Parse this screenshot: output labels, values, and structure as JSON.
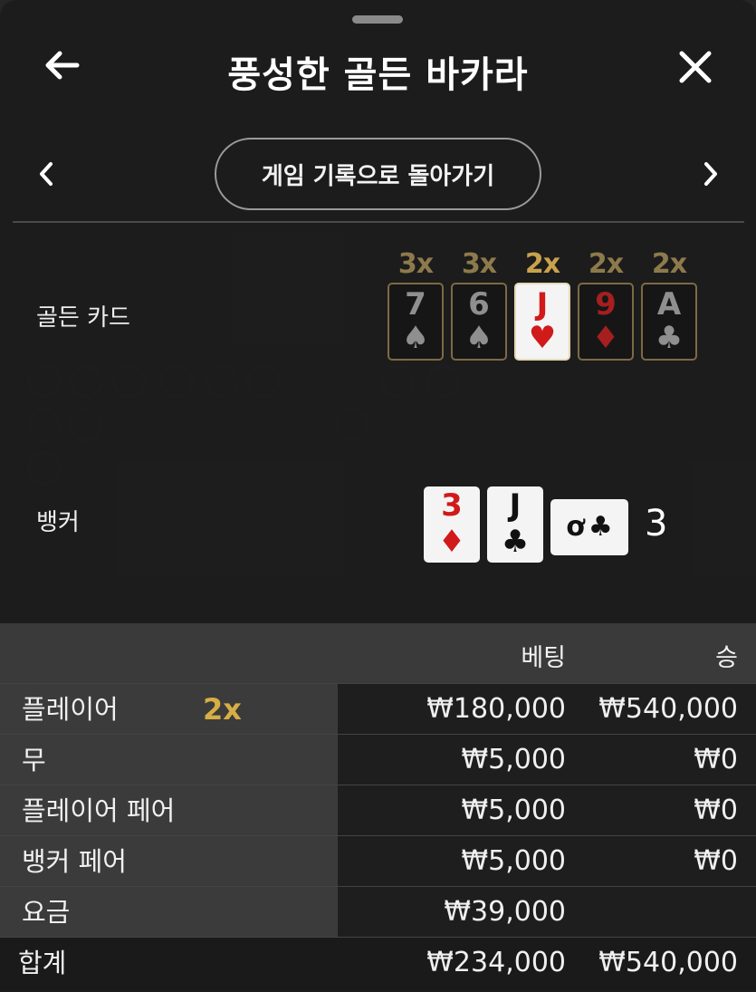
{
  "header": {
    "title": "풍성한 골든 바카라"
  },
  "nav": {
    "history_button": "게임 기록으로 돌아가기"
  },
  "golden": {
    "label": "골든 카드",
    "cards": [
      {
        "mult": "3x",
        "rank": "7",
        "suit": "♠",
        "color": "black",
        "style": "dark"
      },
      {
        "mult": "3x",
        "rank": "6",
        "suit": "♠",
        "color": "black",
        "style": "dark"
      },
      {
        "mult": "2x",
        "rank": "J",
        "suit": "♥",
        "color": "red",
        "style": "face"
      },
      {
        "mult": "2x",
        "rank": "9",
        "suit": "♦",
        "color": "red",
        "style": "dark"
      },
      {
        "mult": "2x",
        "rank": "A",
        "suit": "♣",
        "color": "black",
        "style": "dark"
      }
    ]
  },
  "banker": {
    "label": "뱅커",
    "cards": [
      {
        "rank": "3",
        "suit": "♦",
        "color": "red"
      },
      {
        "rank": "J",
        "suit": "♣",
        "color": "black"
      },
      {
        "rank": "ơ",
        "suit": "♣",
        "color": "black"
      }
    ],
    "total": "3"
  },
  "table": {
    "col_bet": "베팅",
    "col_win": "승",
    "rows": [
      {
        "label": "플레이어",
        "mult": "2x",
        "bet": "₩180,000",
        "win": "₩540,000"
      },
      {
        "label": "무",
        "mult": "",
        "bet": "₩5,000",
        "win": "₩0"
      },
      {
        "label": "플레이어 페어",
        "mult": "",
        "bet": "₩5,000",
        "win": "₩0"
      },
      {
        "label": "뱅커 페어",
        "mult": "",
        "bet": "₩5,000",
        "win": "₩0"
      },
      {
        "label": "요금",
        "mult": "",
        "bet": "₩39,000",
        "win": ""
      }
    ],
    "total": {
      "label": "합계",
      "bet": "₩234,000",
      "win": "₩540,000"
    }
  },
  "colors": {
    "gold": "#c9a24c",
    "red_suit": "#d11a1a",
    "sheet_bg": "#1c1c1c"
  },
  "icons": {
    "back": "arrow-left-icon",
    "close": "close-icon",
    "prev": "chevron-left-icon",
    "next": "chevron-right-icon"
  }
}
